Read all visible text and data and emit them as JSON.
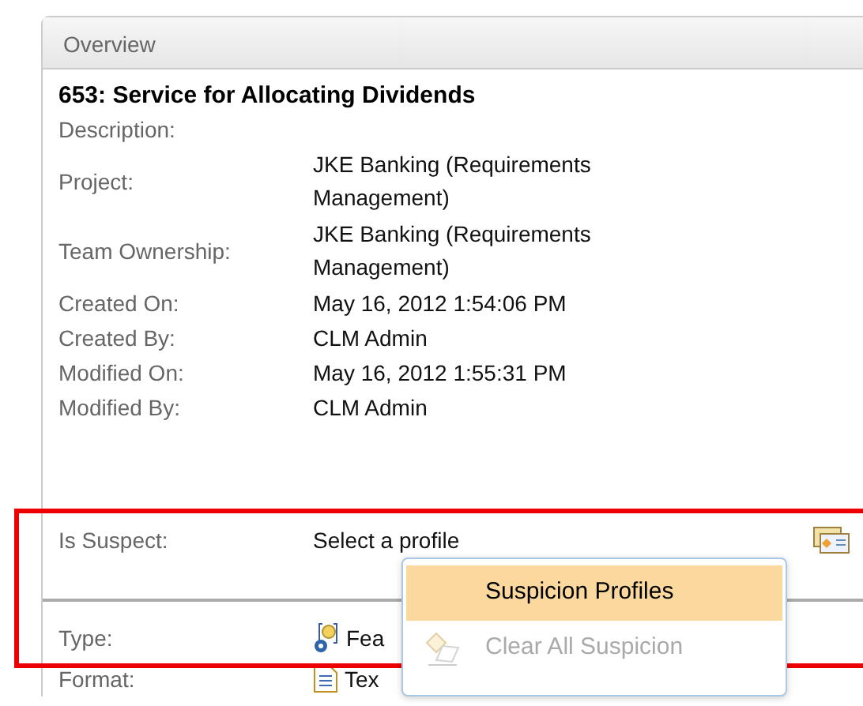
{
  "panel": {
    "title": "Overview",
    "heading": "653: Service for Allocating Dividends",
    "fields": [
      {
        "label": "Description:"
      },
      {
        "label": "Project:",
        "value": "JKE Banking (Requirements Management)"
      },
      {
        "label": "Team Ownership:",
        "value": "JKE Banking (Requirements Management)"
      },
      {
        "label": "Created On:",
        "value": "May 16, 2012 1:54:06 PM"
      },
      {
        "label": "Created By:",
        "value": "CLM Admin"
      },
      {
        "label": "Modified On:",
        "value": "May 16, 2012 1:55:31 PM"
      },
      {
        "label": "Modified By:",
        "value": "CLM Admin"
      }
    ],
    "suspect": {
      "label": "Is Suspect:",
      "value": "Select a profile"
    },
    "lower_fields": [
      {
        "label": "Type:",
        "value": "Fea",
        "kind": "type"
      },
      {
        "label": "Format:",
        "value": "Tex",
        "kind": "format"
      }
    ],
    "menu": [
      {
        "label": "Suspicion Profiles",
        "selected": true,
        "disabled": false,
        "kind": "plain"
      },
      {
        "label": "Clear All Suspicion",
        "selected": false,
        "disabled": true,
        "kind": "clear"
      }
    ]
  }
}
